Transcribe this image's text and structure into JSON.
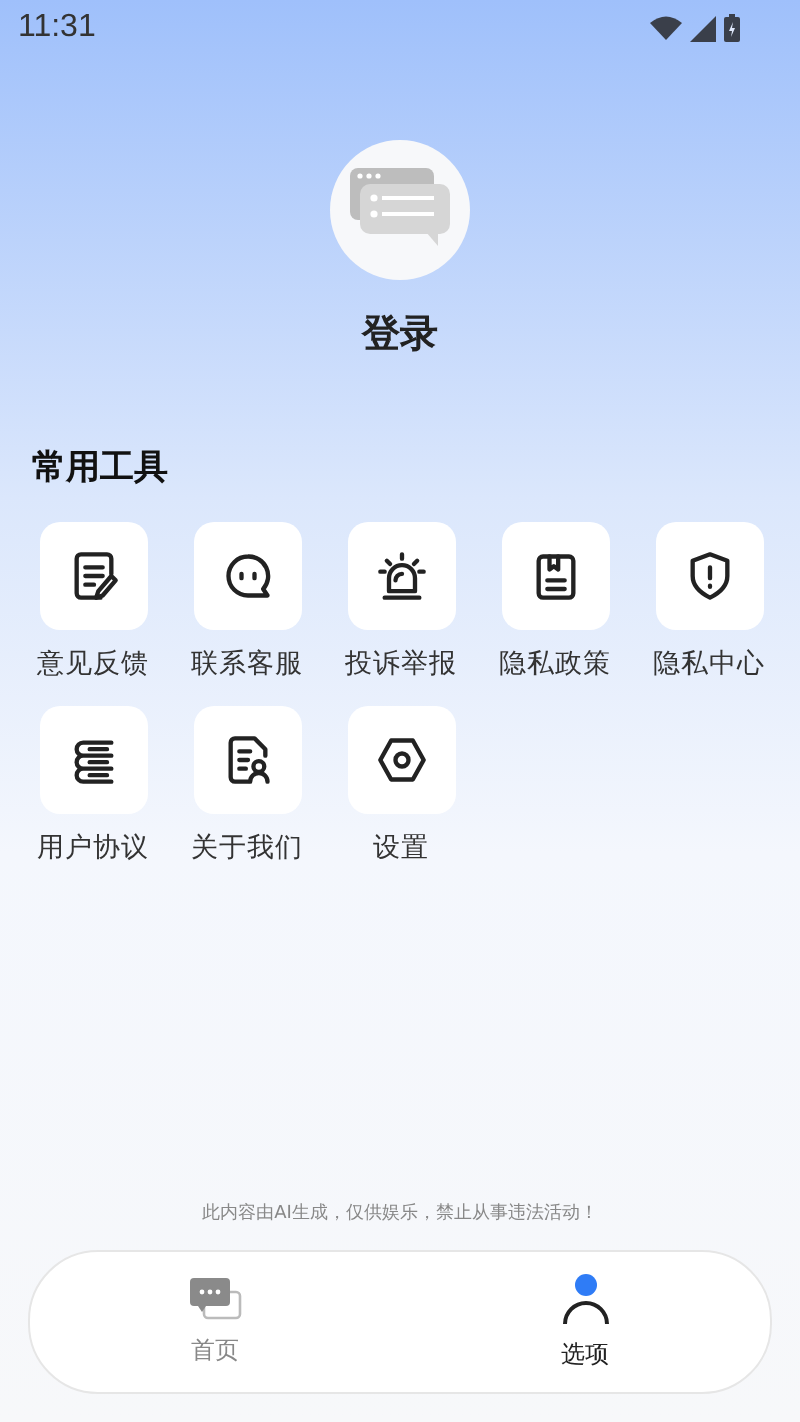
{
  "status_bar": {
    "time": "11:31"
  },
  "profile": {
    "login_label": "登录"
  },
  "section": {
    "title": "常用工具"
  },
  "tools": [
    {
      "label": "意见反馈"
    },
    {
      "label": "联系客服"
    },
    {
      "label": "投诉举报"
    },
    {
      "label": "隐私政策"
    },
    {
      "label": "隐私中心"
    },
    {
      "label": "用户协议"
    },
    {
      "label": "关于我们"
    },
    {
      "label": "设置"
    }
  ],
  "disclaimer": "此内容由AI生成，仅供娱乐，禁止从事违法活动！",
  "nav": [
    {
      "label": "首页",
      "selected": false
    },
    {
      "label": "选项",
      "selected": true
    }
  ]
}
